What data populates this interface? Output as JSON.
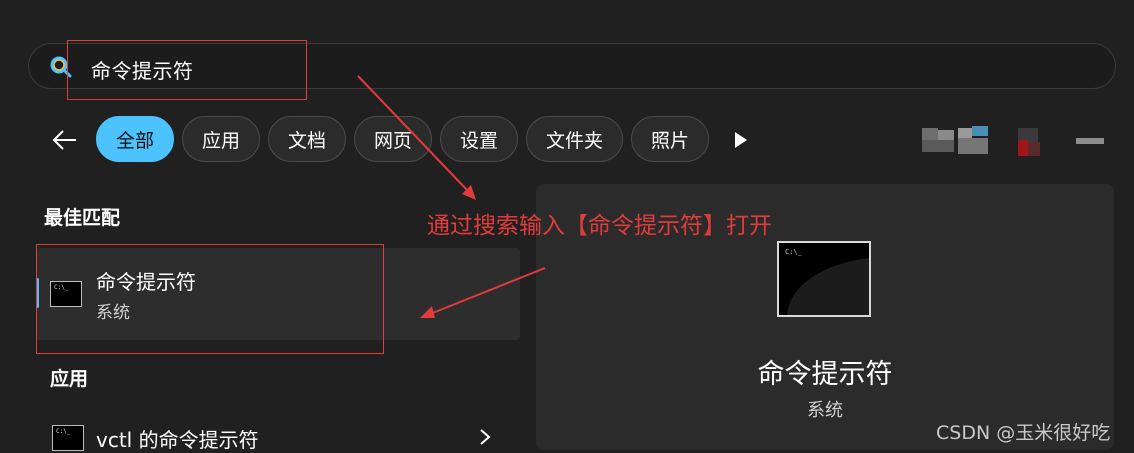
{
  "search": {
    "query": "命令提示符"
  },
  "filters": [
    {
      "label": "全部",
      "active": true
    },
    {
      "label": "应用",
      "active": false
    },
    {
      "label": "文档",
      "active": false
    },
    {
      "label": "网页",
      "active": false
    },
    {
      "label": "设置",
      "active": false
    },
    {
      "label": "文件夹",
      "active": false
    },
    {
      "label": "照片",
      "active": false
    }
  ],
  "best_match": {
    "heading": "最佳匹配",
    "title": "命令提示符",
    "subtitle": "系统"
  },
  "apps": {
    "heading": "应用",
    "items": [
      {
        "title": "vctl 的命令提示符"
      }
    ]
  },
  "preview": {
    "terminal_text": "C:\\_",
    "title": "命令提示符",
    "subtitle": "系统"
  },
  "annotation": {
    "text": "通过搜索输入【命令提示符】打开",
    "color": "#e23b3b"
  },
  "watermark": "CSDN @玉米很好吃",
  "colors": {
    "accent": "#4cc2ff",
    "background": "#202020"
  }
}
